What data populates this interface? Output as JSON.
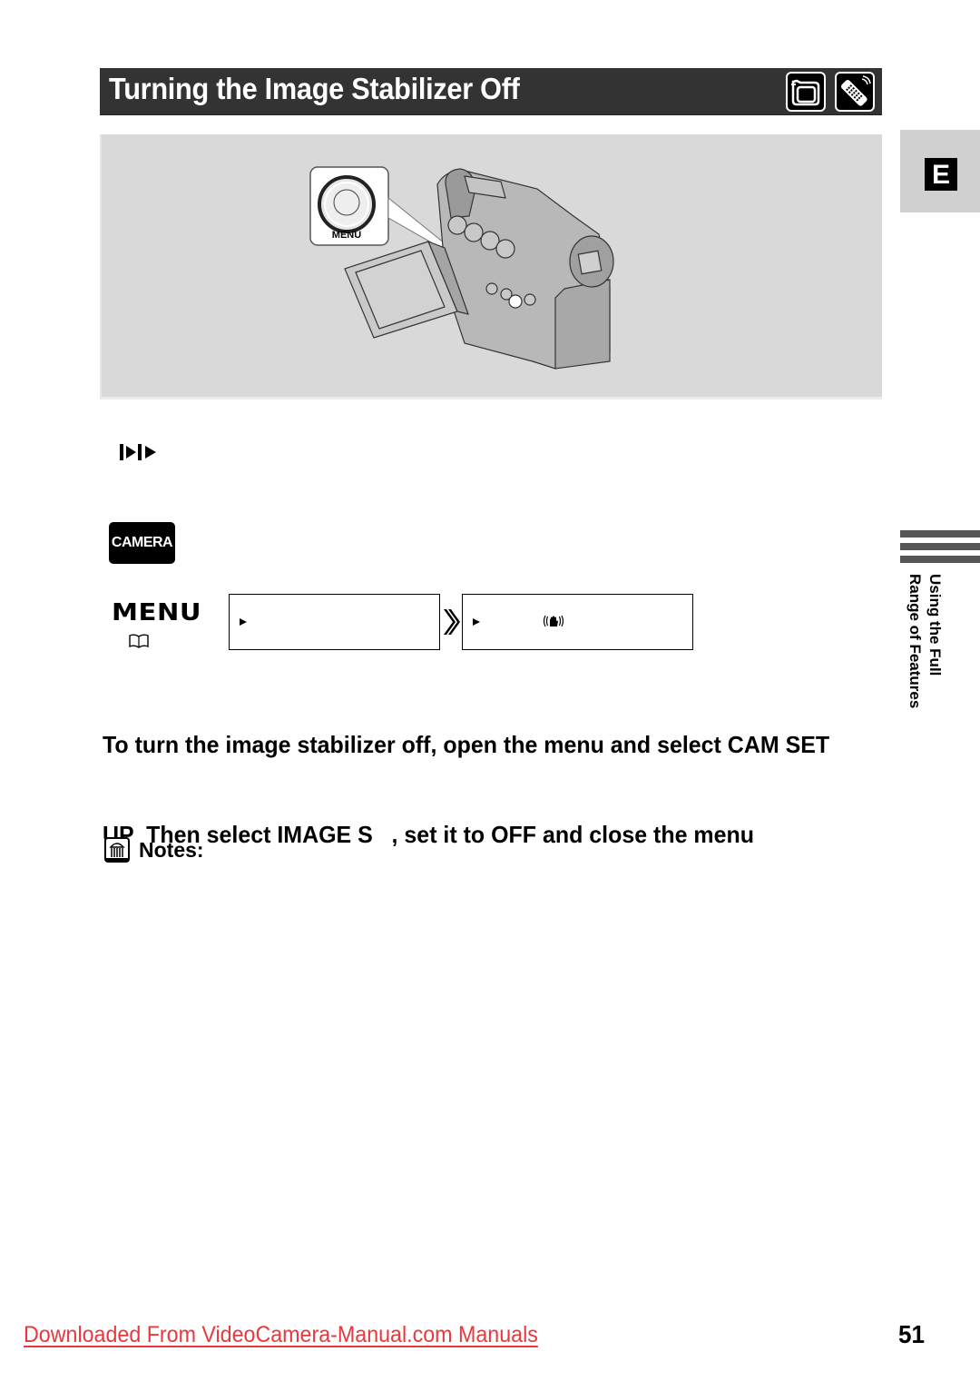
{
  "header": {
    "title": "Turning the Image Stabilizer Off",
    "icons": [
      "camcorder-icon",
      "remote-control-icon"
    ]
  },
  "illustration": {
    "callout_label": "MENU",
    "description": "Camcorder with flip-out LCD, callout pointing to MENU button"
  },
  "side_tab": {
    "language_letter": "E",
    "section_line1": "Using the Full",
    "section_line2": "Range of Features"
  },
  "mode_indicators": {
    "play_icon": "play-pause-play-icon",
    "camera_badge": "CAMERA"
  },
  "menu_path": {
    "menu_label": "MENU",
    "book_icon": "reference-book-icon",
    "step1_text": "",
    "step2_text": "",
    "step2_icon": "image-stabilizer-icon"
  },
  "instruction": {
    "line1": "To turn the image stabilizer off, open the menu and select CAM SET",
    "line2": "UP  Then select IMAGE S   , set it to OFF and close the menu"
  },
  "notes": {
    "label": "Notes:"
  },
  "footer": {
    "link_text": "Downloaded From VideoCamera-Manual.com Manuals",
    "link_color": "#e8383d",
    "page_number": "51"
  },
  "colors": {
    "title_bar": "#333333",
    "panel_bg": "#d9d9d9",
    "side_tab_bg": "#d0d0d0"
  }
}
